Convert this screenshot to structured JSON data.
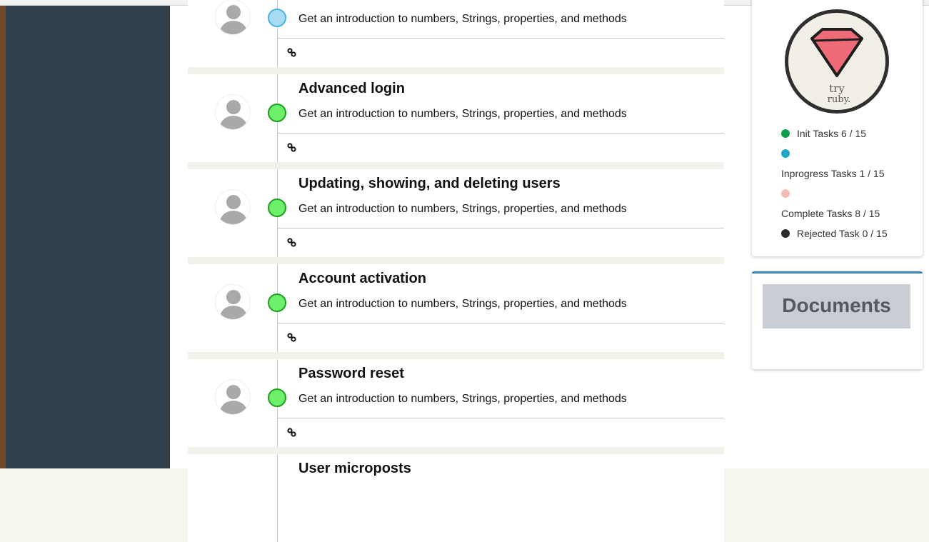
{
  "tasks": [
    {
      "title": "",
      "description": "Get an introduction to numbers, Strings, properties, and methods",
      "status": "inprogress"
    },
    {
      "title": "Advanced login",
      "description": "Get an introduction to numbers, Strings, properties, and methods",
      "status": "init"
    },
    {
      "title": "Updating, showing, and deleting users",
      "description": "Get an introduction to numbers, Strings, properties, and methods",
      "status": "init"
    },
    {
      "title": "Account activation",
      "description": "Get an introduction to numbers, Strings, properties, and methods",
      "status": "init"
    },
    {
      "title": "Password reset",
      "description": "Get an introduction to numbers, Strings, properties, and methods",
      "status": "init"
    },
    {
      "title": "User microposts",
      "description": "",
      "status": "init"
    }
  ],
  "status_summary": {
    "logo_text": "try ruby.",
    "items": [
      {
        "label": "Init Tasks",
        "count": "6 / 15",
        "color": "#0aa14a"
      },
      {
        "label": "Inprogress Tasks",
        "count": "1 / 15",
        "color": "#1fa9c6"
      },
      {
        "label": "Complete Tasks",
        "count": "8 / 15",
        "color": "#f3bcb0"
      },
      {
        "label": "Rejected Task",
        "count": "0 / 15",
        "color": "#2b2b2b"
      }
    ]
  },
  "documents": {
    "label": "Documents"
  },
  "colors": {
    "sidebar": "#2f3e48",
    "accent": "#3b82b8",
    "green_dot": "#6cf06c",
    "blue_dot": "#a8dcf5"
  }
}
